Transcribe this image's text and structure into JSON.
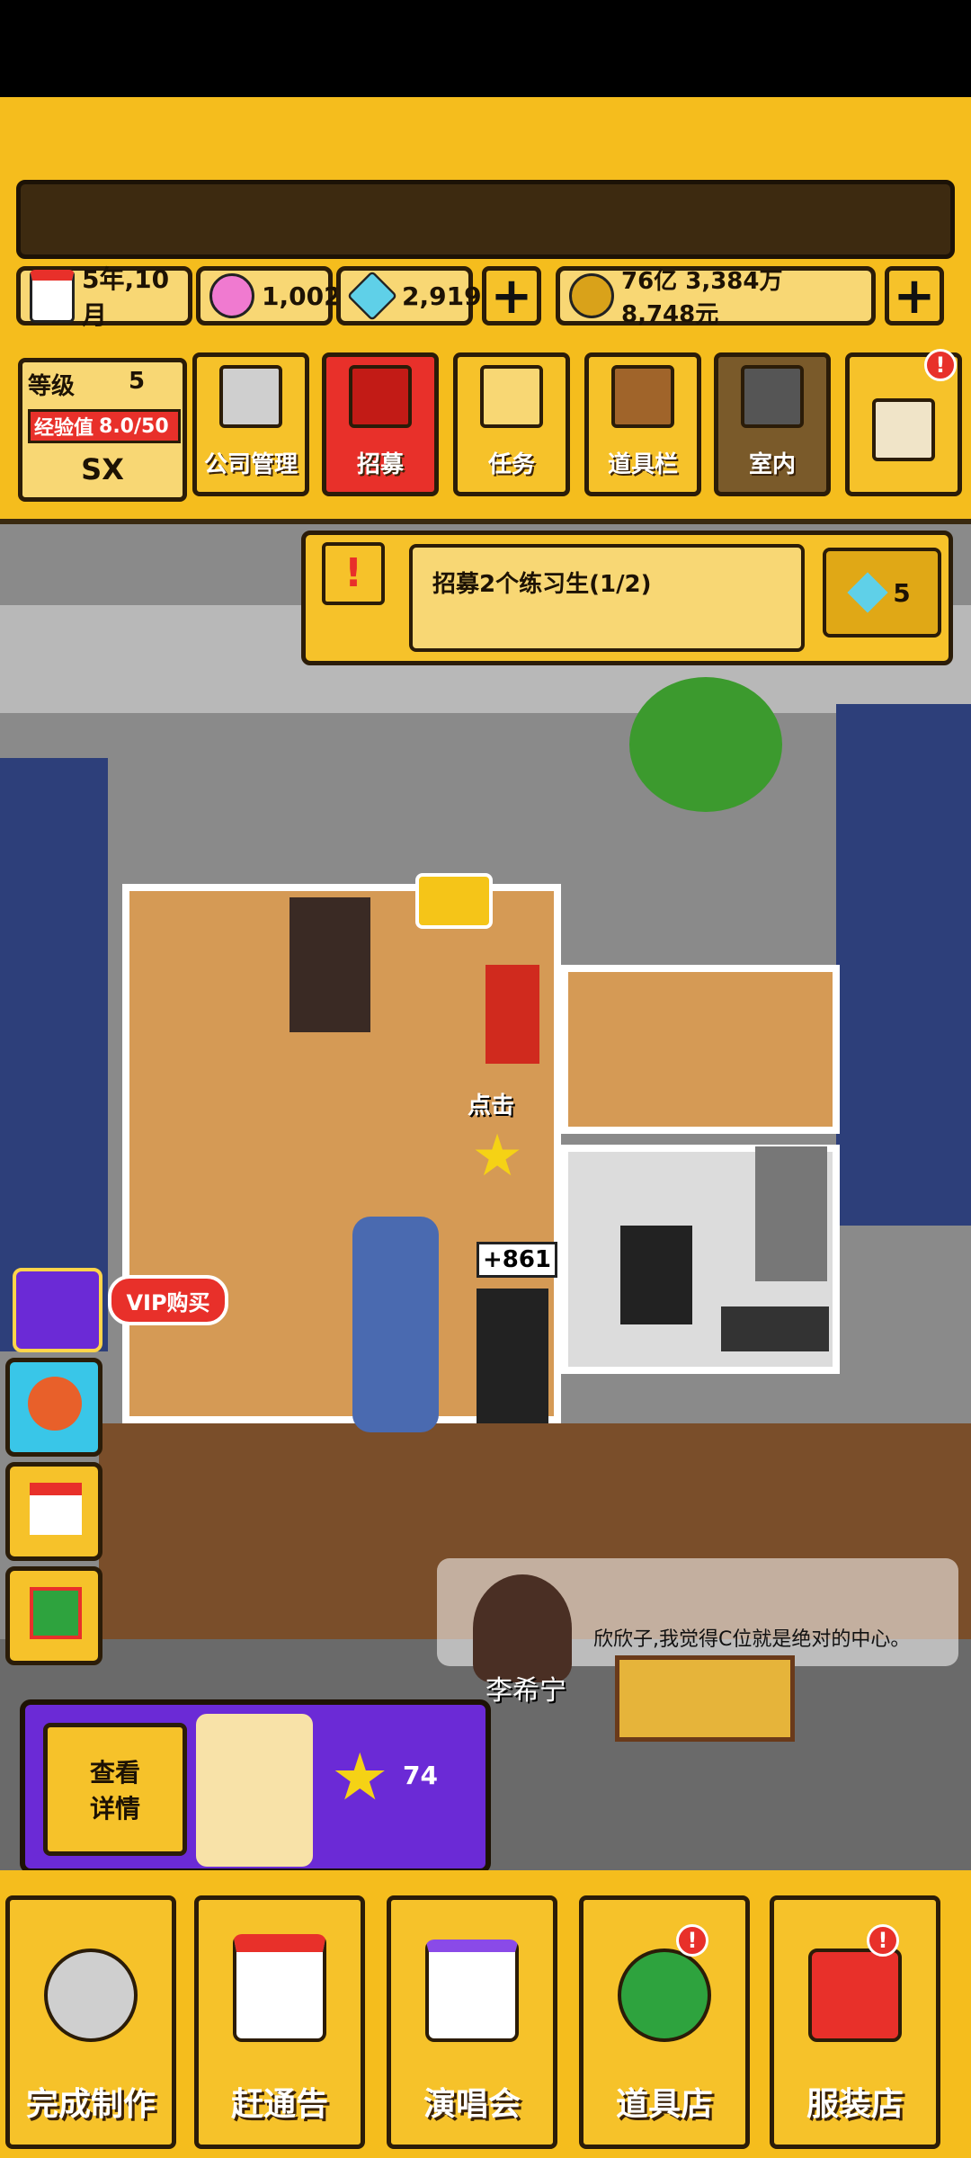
{
  "hud": {
    "date": "5年,10月",
    "gems": "1,002",
    "diamonds": "2,919",
    "money": "76亿 3,384万 8,748元",
    "level_label": "等级",
    "level_value": "5",
    "exp_label": "经验值",
    "exp_value": "8.0/50",
    "rank": "SX"
  },
  "menu": {
    "company": "公司管理",
    "recruit": "招募",
    "task": "任务",
    "items": "道具栏",
    "interior": "室内"
  },
  "quest": {
    "text": "招募2个练习生(1/2)",
    "reward": "5"
  },
  "scene": {
    "tap_hint": "点击",
    "reward_popup": "+861",
    "vip_label": "VIP购买",
    "npc_name": "李希宁",
    "speech": "欣欣子,我觉得C位就是绝对的中心。"
  },
  "card": {
    "detail_button": "查看\n详情",
    "star_count": "74"
  },
  "bottom_nav": {
    "complete": "完成制作",
    "schedule": "赶通告",
    "concert": "演唱会",
    "item_shop": "道具店",
    "clothes_shop": "服装店"
  },
  "badge": "!",
  "colors": {
    "accent_yellow": "#f5bd1d",
    "dark_brown": "#2b1c08",
    "recruit_red": "#e8302a",
    "vip_purple": "#6b2ad6"
  }
}
